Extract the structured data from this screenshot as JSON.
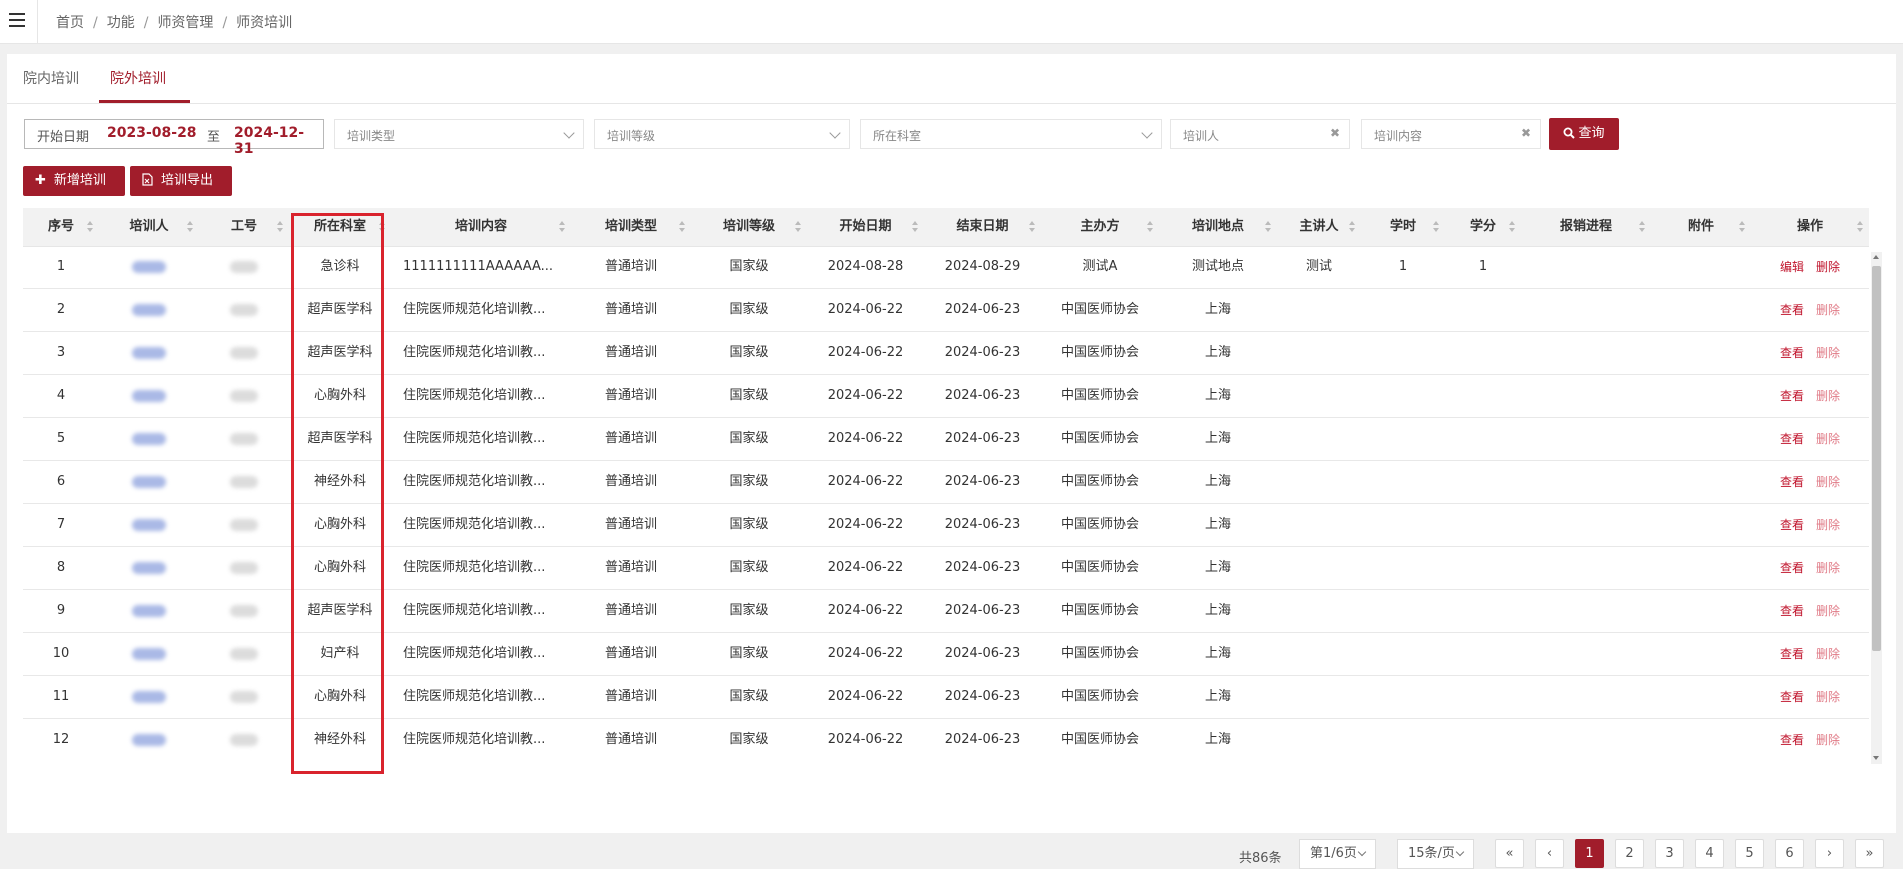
{
  "breadcrumb": [
    "首页",
    "功能",
    "师资管理",
    "师资培训"
  ],
  "tabs": [
    "院内培训",
    "院外培训"
  ],
  "filters": {
    "date_start_label": "开始日期",
    "date_start": "2023-08-28",
    "date_to": "至",
    "date_end": "2024-12-31",
    "type_placeholder": "培训类型",
    "level_placeholder": "培训等级",
    "dept_placeholder": "所在科室",
    "trainee_placeholder": "培训人",
    "content_placeholder": "培训内容",
    "search_label": "查询"
  },
  "actions": {
    "add_label": "新增培训",
    "export_label": "培训导出"
  },
  "columns": [
    "序号",
    "培训人",
    "工号",
    "所在科室",
    "培训内容",
    "培训类型",
    "培训等级",
    "开始日期",
    "结束日期",
    "主办方",
    "培训地点",
    "主讲人",
    "学时",
    "学分",
    "报销进程",
    "附件",
    "操作"
  ],
  "rows": [
    {
      "no": "1",
      "dept": "急诊科",
      "content": "1111111111AAAAAA...",
      "type": "普通培训",
      "level": "国家级",
      "start": "2024-08-28",
      "end": "2024-08-29",
      "host": "测试A",
      "place": "测试地点",
      "speaker": "测试",
      "hours": "1",
      "credit": "1",
      "op1": "编辑",
      "op2": "删除"
    },
    {
      "no": "2",
      "dept": "超声医学科",
      "content": "住院医师规范化培训教...",
      "type": "普通培训",
      "level": "国家级",
      "start": "2024-06-22",
      "end": "2024-06-23",
      "host": "中国医师协会",
      "place": "上海",
      "speaker": "",
      "hours": "",
      "credit": "",
      "op1": "查看",
      "op2": "删除"
    },
    {
      "no": "3",
      "dept": "超声医学科",
      "content": "住院医师规范化培训教...",
      "type": "普通培训",
      "level": "国家级",
      "start": "2024-06-22",
      "end": "2024-06-23",
      "host": "中国医师协会",
      "place": "上海",
      "speaker": "",
      "hours": "",
      "credit": "",
      "op1": "查看",
      "op2": "删除"
    },
    {
      "no": "4",
      "dept": "心胸外科",
      "content": "住院医师规范化培训教...",
      "type": "普通培训",
      "level": "国家级",
      "start": "2024-06-22",
      "end": "2024-06-23",
      "host": "中国医师协会",
      "place": "上海",
      "speaker": "",
      "hours": "",
      "credit": "",
      "op1": "查看",
      "op2": "删除"
    },
    {
      "no": "5",
      "dept": "超声医学科",
      "content": "住院医师规范化培训教...",
      "type": "普通培训",
      "level": "国家级",
      "start": "2024-06-22",
      "end": "2024-06-23",
      "host": "中国医师协会",
      "place": "上海",
      "speaker": "",
      "hours": "",
      "credit": "",
      "op1": "查看",
      "op2": "删除"
    },
    {
      "no": "6",
      "dept": "神经外科",
      "content": "住院医师规范化培训教...",
      "type": "普通培训",
      "level": "国家级",
      "start": "2024-06-22",
      "end": "2024-06-23",
      "host": "中国医师协会",
      "place": "上海",
      "speaker": "",
      "hours": "",
      "credit": "",
      "op1": "查看",
      "op2": "删除"
    },
    {
      "no": "7",
      "dept": "心胸外科",
      "content": "住院医师规范化培训教...",
      "type": "普通培训",
      "level": "国家级",
      "start": "2024-06-22",
      "end": "2024-06-23",
      "host": "中国医师协会",
      "place": "上海",
      "speaker": "",
      "hours": "",
      "credit": "",
      "op1": "查看",
      "op2": "删除"
    },
    {
      "no": "8",
      "dept": "心胸外科",
      "content": "住院医师规范化培训教...",
      "type": "普通培训",
      "level": "国家级",
      "start": "2024-06-22",
      "end": "2024-06-23",
      "host": "中国医师协会",
      "place": "上海",
      "speaker": "",
      "hours": "",
      "credit": "",
      "op1": "查看",
      "op2": "删除"
    },
    {
      "no": "9",
      "dept": "超声医学科",
      "content": "住院医师规范化培训教...",
      "type": "普通培训",
      "level": "国家级",
      "start": "2024-06-22",
      "end": "2024-06-23",
      "host": "中国医师协会",
      "place": "上海",
      "speaker": "",
      "hours": "",
      "credit": "",
      "op1": "查看",
      "op2": "删除"
    },
    {
      "no": "10",
      "dept": "妇产科",
      "content": "住院医师规范化培训教...",
      "type": "普通培训",
      "level": "国家级",
      "start": "2024-06-22",
      "end": "2024-06-23",
      "host": "中国医师协会",
      "place": "上海",
      "speaker": "",
      "hours": "",
      "credit": "",
      "op1": "查看",
      "op2": "删除"
    },
    {
      "no": "11",
      "dept": "心胸外科",
      "content": "住院医师规范化培训教...",
      "type": "普通培训",
      "level": "国家级",
      "start": "2024-06-22",
      "end": "2024-06-23",
      "host": "中国医师协会",
      "place": "上海",
      "speaker": "",
      "hours": "",
      "credit": "",
      "op1": "查看",
      "op2": "删除"
    },
    {
      "no": "12",
      "dept": "神经外科",
      "content": "住院医师规范化培训教...",
      "type": "普通培训",
      "level": "国家级",
      "start": "2024-06-22",
      "end": "2024-06-23",
      "host": "中国医师协会",
      "place": "上海",
      "speaker": "",
      "hours": "",
      "credit": "",
      "op1": "查看",
      "op2": "删除"
    }
  ],
  "pagination": {
    "total": "共86条",
    "page_select": "第1/6页",
    "size_select": "15条/页",
    "first": "«",
    "prev": "‹",
    "pages": [
      "1",
      "2",
      "3",
      "4",
      "5",
      "6"
    ],
    "current": "1",
    "next": "›",
    "last": "»"
  },
  "colors": {
    "accent": "#a11d2b",
    "highlight_box": "#d9232d",
    "link": "#c0142c"
  }
}
